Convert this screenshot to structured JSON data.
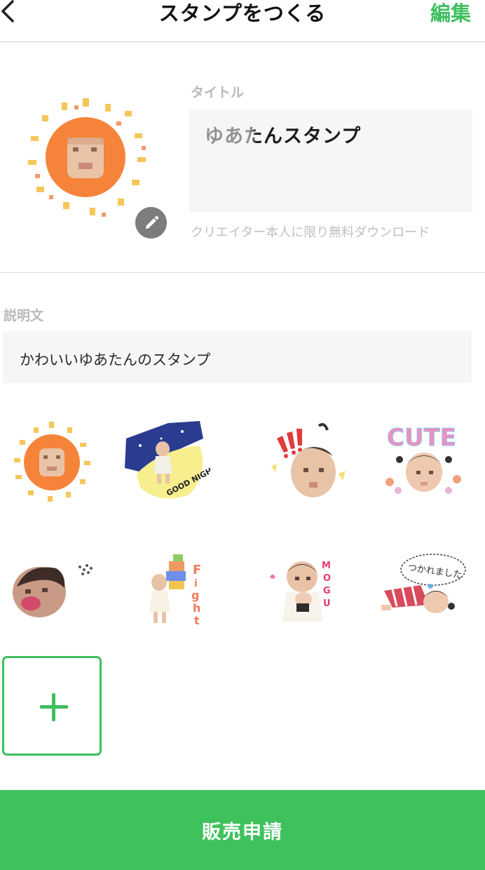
{
  "header": {
    "title": "スタンプをつくる",
    "edit_label": "編集",
    "back_icon": "chevron-left-icon"
  },
  "cover": {
    "image": "sun-baby-cover",
    "edit_icon": "pencil-icon"
  },
  "title_field": {
    "label": "タイトル",
    "value": "ゆあたんスタンプ",
    "note": "クリエイター本人に限り無料ダウンロード"
  },
  "description_field": {
    "label": "説明文",
    "value": "かわいいゆあたんのスタンプ"
  },
  "stamps": [
    {
      "name": "stamp-sun-baby"
    },
    {
      "name": "stamp-good-night",
      "text": "GOOD NIGHT"
    },
    {
      "name": "stamp-surprised-baby"
    },
    {
      "name": "stamp-cute-baby",
      "text": "CUTE"
    },
    {
      "name": "stamp-sigh-baby"
    },
    {
      "name": "stamp-fight-baby",
      "text": "Fight"
    },
    {
      "name": "stamp-mogu-baby",
      "text": "MOGU"
    },
    {
      "name": "stamp-tired-baby",
      "text": "つかれました"
    }
  ],
  "add_stamp": {
    "icon": "plus-icon"
  },
  "submit": {
    "label": "販売申請"
  },
  "colors": {
    "accent": "#3fc25d",
    "cover_sun": "#f5843a"
  }
}
